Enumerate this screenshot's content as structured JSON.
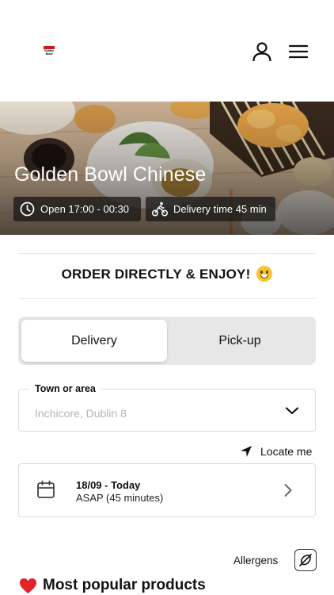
{
  "header": {
    "logo_text": "Golden Bowl",
    "icons": {
      "account": "user-icon",
      "menu": "hamburger-menu-icon"
    }
  },
  "hero": {
    "restaurant_name": "Golden Bowl Chinese",
    "open_hours": "Open 17:00 - 00:30",
    "delivery_time": "Delivery time 45 min",
    "icons": {
      "hours": "clock-icon",
      "delivery": "bicycle-icon"
    }
  },
  "promo": {
    "text": "ORDER DIRECTLY & ENJOY!",
    "emoji": "grinning-face-emoji"
  },
  "order_type": {
    "options": [
      "Delivery",
      "Pick-up"
    ],
    "selected": "Delivery"
  },
  "town_field": {
    "label": "Town or area",
    "placeholder": "Inchicore, Dublin 8"
  },
  "locate": {
    "label": "Locate me",
    "icon": "location-arrow-icon"
  },
  "schedule": {
    "date": "18/09 - Today",
    "time": "ASAP (45 minutes)",
    "icon": "calendar-icon"
  },
  "allergens": {
    "label": "Allergens",
    "icon": "no-allergen-icon"
  },
  "section": {
    "title": "Most popular products",
    "icon": "heart-icon"
  },
  "colors": {
    "accent_red": "#e2232a",
    "chip_bg": "#1a1a1a",
    "segment_bg": "#e7e7e7",
    "emoji_yellow": "#f7c52b"
  }
}
